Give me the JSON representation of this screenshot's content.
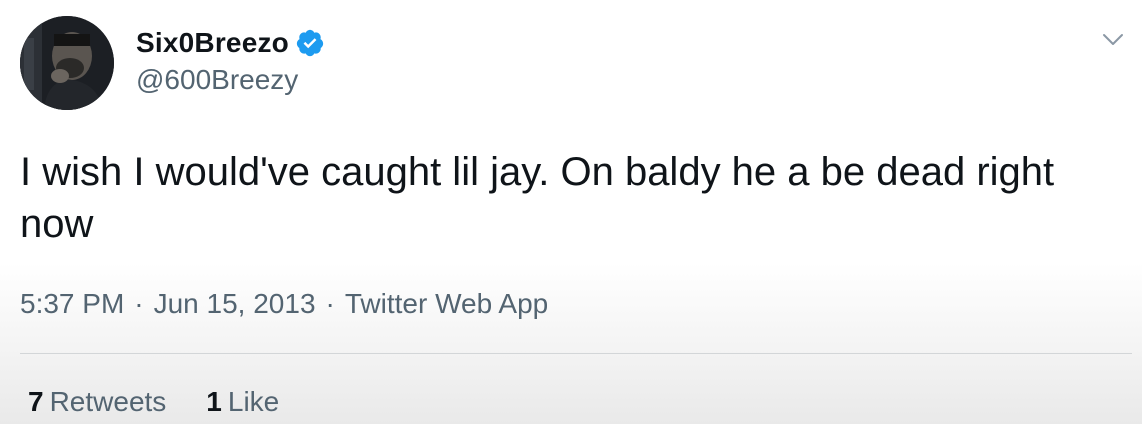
{
  "author": {
    "display_name": "Six0Breezo",
    "handle": "@600Breezy",
    "verified": true
  },
  "tweet": {
    "text": "I wish I would've caught lil jay. On baldy he a be dead right now",
    "time": "5:37 PM",
    "date": "Jun 15, 2013",
    "separator": "·",
    "source": "Twitter Web App"
  },
  "stats": {
    "retweets_count": "7",
    "retweets_label": "Retweets",
    "likes_count": "1",
    "likes_label": "Like"
  },
  "icons": {
    "verified": "verified-badge-icon",
    "more": "chevron-down-icon"
  },
  "colors": {
    "verified_blue": "#1d9bf0",
    "text_primary": "#0f1419",
    "text_secondary": "#536471"
  }
}
